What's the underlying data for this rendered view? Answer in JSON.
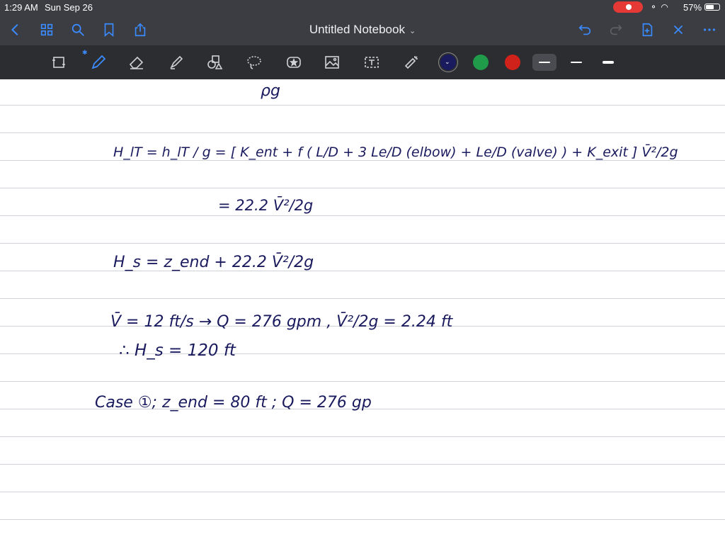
{
  "status": {
    "time": "1:29 AM",
    "date": "Sun Sep 26",
    "battery": "57%"
  },
  "app": {
    "title": "Untitled Notebook"
  },
  "icons": {
    "nav_left": [
      "back-icon",
      "grid-icon",
      "search-icon",
      "bookmark-icon",
      "share-icon"
    ],
    "nav_right": [
      "undo-icon",
      "redo-icon",
      "add-page-icon",
      "close-icon",
      "more-icon"
    ],
    "tools": [
      "lasso-crop-icon",
      "pen-icon",
      "eraser-icon",
      "highlighter-icon",
      "shapes-icon",
      "lasso-icon",
      "sticker-icon",
      "image-icon",
      "text-icon",
      "laser-pointer-icon"
    ]
  },
  "colors": {
    "accent": "#3a8bff",
    "pen_navy": "#1a1a5e",
    "swatch_green": "#1f9b4a",
    "swatch_red": "#d0211b",
    "ink": "#1a1a5e"
  },
  "notes": {
    "line0": "ρg",
    "line1": "H_lT = h_lT / g = [ K_ent + f ( L/D + 3 Le/D (elbow) + Le/D (valve) ) + K_exit ] V̄²/2g",
    "line2": "= 22.2 V̄²/2g",
    "line3": "H_s = z_end + 22.2 V̄²/2g",
    "line4": "V̄ = 12 ft/s → Q = 276 gpm , V̄²/2g = 2.24 ft",
    "line5": "∴ H_s = 120 ft",
    "line6": "Case ①; z_end = 80 ft   ;   Q = 276 gp"
  }
}
